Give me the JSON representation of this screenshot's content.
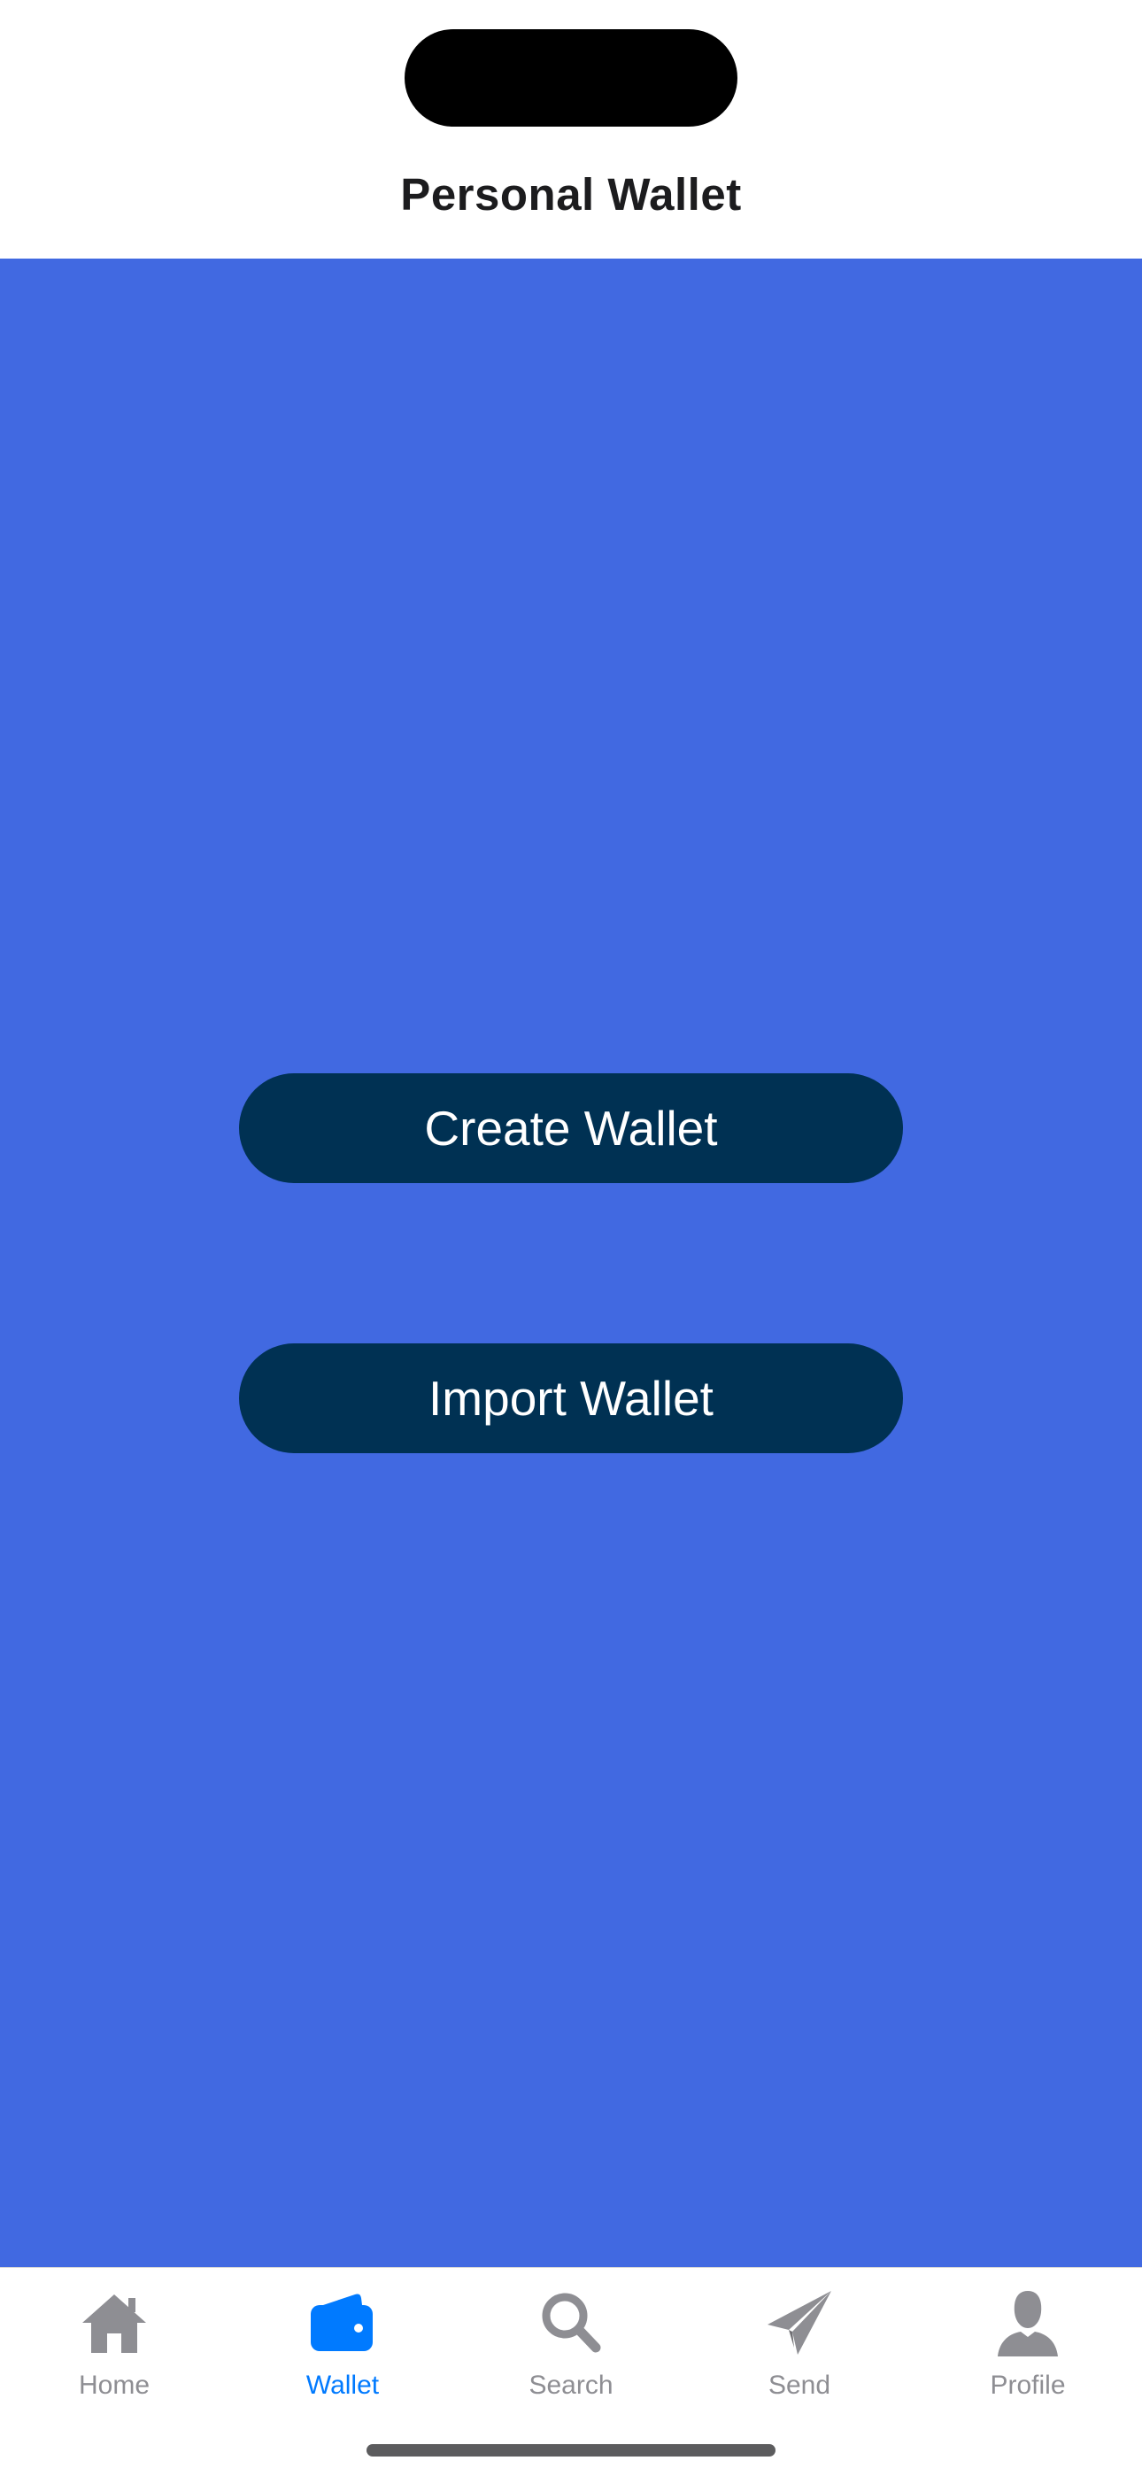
{
  "header": {
    "title": "Personal Wallet"
  },
  "main": {
    "create_button_label": "Create Wallet",
    "import_button_label": "Import Wallet"
  },
  "tab_bar": {
    "active": "wallet",
    "tabs": [
      {
        "id": "home",
        "label": "Home",
        "icon": "house-icon"
      },
      {
        "id": "wallet",
        "label": "Wallet",
        "icon": "wallet-icon"
      },
      {
        "id": "search",
        "label": "Search",
        "icon": "magnifying-glass-icon"
      },
      {
        "id": "send",
        "label": "Send",
        "icon": "paper-plane-icon"
      },
      {
        "id": "profile",
        "label": "Profile",
        "icon": "person-icon"
      }
    ]
  },
  "colors": {
    "background": "#4169e1",
    "button": "#003153",
    "tab_active": "#007aff",
    "tab_inactive": "#8e8e93"
  }
}
